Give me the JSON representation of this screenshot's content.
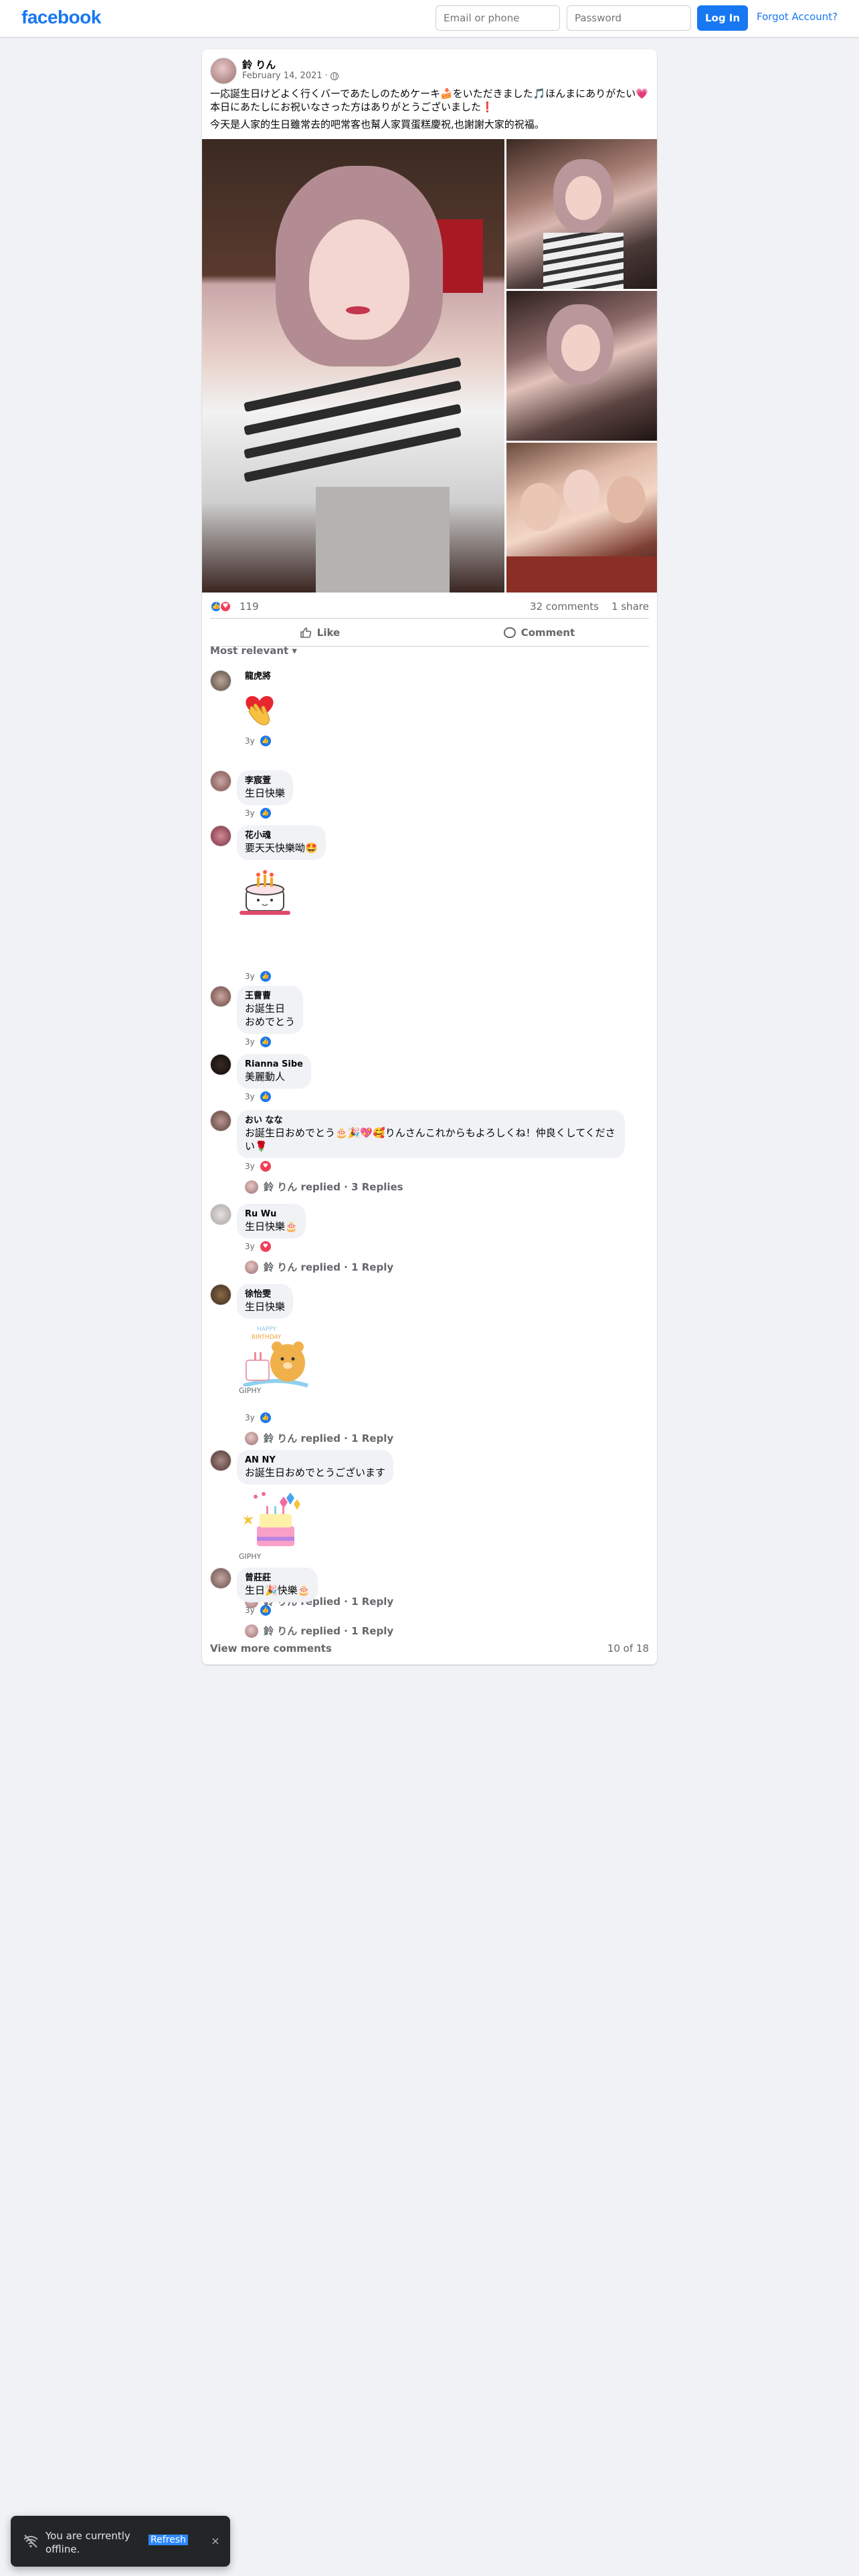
{
  "header": {
    "logo": "facebook",
    "email_placeholder": "Email or phone",
    "password_placeholder": "Password",
    "login_label": "Log In",
    "forgot_label": "Forgot Account?"
  },
  "post": {
    "author": "鈴 りん",
    "date": "February 14, 2021",
    "separator": "·",
    "text_line1": "一応誕生日けどよく行くバーであたしのためケーキ🍰をいただきました🎵ほんまにありがたい💗",
    "text_line2": "本日にあたしにお祝いなさった方はありがとうございました❗",
    "text_line3": "今天是人家的生日雖常去的吧常客也幫人家買蛋糕慶祝,也謝謝大家的祝福。",
    "reaction_count": "119",
    "comments_count": "32 comments",
    "shares_count": "1 share",
    "like_label": "Like",
    "comment_label": "Comment",
    "sort_label": "Most relevant ▾"
  },
  "comments": [
    {
      "name": "龍虎將",
      "text": "",
      "time": "3y",
      "sticker": "heart-hand-sticker"
    },
    {
      "name": "李宸萱",
      "text": "生日快樂",
      "time": "3y"
    },
    {
      "name": "花小魂",
      "text": "要天天快樂呦🤩",
      "time": "3y",
      "sticker": "cake-sticker"
    },
    {
      "name": "王曹曹",
      "text": "お誕生日\nおめでとう",
      "time": "3y"
    },
    {
      "name": "Rianna Sibe",
      "text": "美麗動人",
      "time": "3y"
    },
    {
      "name": "おい なな",
      "text": "お誕生日おめでとう🎂🎉💖🥰りんさんこれからもよろしくね！仲良くしてください🌹",
      "time": "3y",
      "reply": "鈴 りん replied · 3 Replies"
    },
    {
      "name": "Ru Wu",
      "text": "生日快樂🎂",
      "time": "3y",
      "reply": "鈴 りん replied · 1 Reply"
    },
    {
      "name": "徐怡雯",
      "text": "生日快樂",
      "time": "3y",
      "sticker": "giphy-bear-cake",
      "giphy": "GIPHY",
      "reply": "鈴 りん replied · 1 Reply"
    },
    {
      "name": "AN NY",
      "text": "お誕生日おめでとうございます",
      "time": "3y",
      "sticker": "giphy-cake-balloons",
      "giphy": "GIPHY",
      "reply": "鈴 りん replied · 1 Reply"
    },
    {
      "name": "曾莊莊",
      "text": "生日🎉快樂🎂",
      "time": "3y",
      "reply": "鈴 りん replied · 1 Reply"
    }
  ],
  "footer": {
    "view_more": "View more comments",
    "paging": "10 of 18"
  },
  "toast": {
    "text": "You are currently offline.",
    "refresh": "Refresh",
    "close": "×"
  },
  "colors": {
    "brand": "#1877f2",
    "like": "#1877f2",
    "love": "#f33e58",
    "background": "#f0f2f5"
  }
}
